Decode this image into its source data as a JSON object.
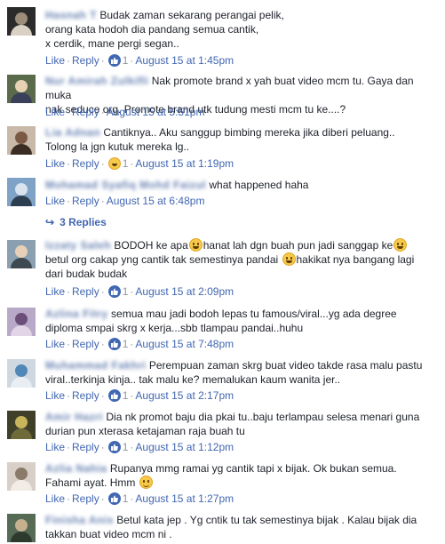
{
  "labels": {
    "like": "Like",
    "reply": "Reply",
    "dot": "·"
  },
  "comments": [
    {
      "author": "Hasnah T",
      "text": "Budak zaman sekarang perangai pelik,",
      "text2": "orang kata hodoh dia pandang semua cantik,",
      "text3": "x cerdik, mane pergi segan..",
      "reaction": "like",
      "count": "1",
      "time": "August 15 at 1:45pm",
      "avatar_colors": [
        "#2b2b2b",
        "#9c8d7a",
        "#d9d2c4"
      ]
    },
    {
      "author": "Nur Amirah Zulkifli",
      "text": "Nak promote brand x yah buat video mcm tu. Gaya dan muka",
      "text2": "nak seduce org. Promote brand utk tudung mesti mcm tu ke....?",
      "time": "August 15 at 5:51pm",
      "avatar_colors": [
        "#5a6b4b",
        "#e7d3b3",
        "#3a3f5a"
      ]
    },
    {
      "author": "Lia Adnan",
      "text": "Cantiknya.. Aku sanggup bimbing mereka jika diberi peluang..",
      "text2": "Tolong la jgn kutuk mereka lg..",
      "reaction": "laugh",
      "count": "1",
      "time": "August 15 at 1:19pm",
      "avatar_colors": [
        "#c9b9a8",
        "#7a5a45",
        "#3b2c24"
      ]
    },
    {
      "author": "Mohamad Syafiq Mohd Faizul",
      "text": "what happened haha",
      "time": "August 15 at 6:48pm",
      "avatar_colors": [
        "#7fa3c7",
        "#d8e3ee",
        "#2d3e50"
      ],
      "replies": "3 Replies"
    },
    {
      "author": "Izzaty Saleh",
      "text": "BODOH ke apa",
      "text_b": "hanat lah dgn buah pun jadi sanggap ke",
      "text2": "betul org cakap yng cantik tak semestinya pandai",
      "text2_b": "hakikat nya bangang lagi",
      "text3": "dari budak budak",
      "reaction": "like",
      "count": "1",
      "time": "August 15 at 2:09pm",
      "avatar_colors": [
        "#8aa0b0",
        "#e8d0b8",
        "#3e4a52"
      ]
    },
    {
      "author": "Azlina Fitry",
      "text": "semua mau jadi bodoh lepas tu famous/viral...yg ada degree",
      "text2": "diploma smpai skrg x kerja...sbb tlampau pandai..huhu",
      "reaction": "like",
      "count": "1",
      "time": "August 15 at 7:48pm",
      "avatar_colors": [
        "#b9a9c9",
        "#6b4f7a",
        "#e2d5e8"
      ]
    },
    {
      "author": "Muhammad Fakhri",
      "text": "Perempuan zaman skrg buat video takde rasa malu pastu",
      "text2": "viral..terkinja kinja.. tak malu ke? memalukan kaum wanita jer..",
      "reaction": "like",
      "count": "1",
      "time": "August 15 at 2:17pm",
      "avatar_colors": [
        "#cfd8e0",
        "#4f87b8",
        "#e8eef3"
      ]
    },
    {
      "author": "Amir Hazri",
      "text": "Dia nk promot baju dia pkai tu..baju terlampau selesa menari guna",
      "text2": "durian pun xterasa ketajaman raja buah tu",
      "reaction": "like",
      "count": "1",
      "time": "August 15 at 1:12pm",
      "avatar_colors": [
        "#3f3f2a",
        "#c8b45a",
        "#6e6a3a"
      ]
    },
    {
      "author": "Azlia Nahia",
      "text": "Rupanya mmg ramai yg cantik tapi x bijak. Ok bukan semua.",
      "text2": "Fahami ayat. Hmm",
      "reaction": "like",
      "count": "1",
      "time": "August 15 at 1:27pm",
      "avatar_colors": [
        "#d8d0c8",
        "#8a7a6a",
        "#f2ece6"
      ]
    },
    {
      "author": "Finisha Anis",
      "text": "Betul kata jep . Yg cntik tu tak semestinya bijak . Kalau bijak dia",
      "text2": "takkan buat video mcm ni .",
      "avatar_colors": [
        "#556b55",
        "#c7b08e",
        "#2e3a2e"
      ]
    }
  ]
}
